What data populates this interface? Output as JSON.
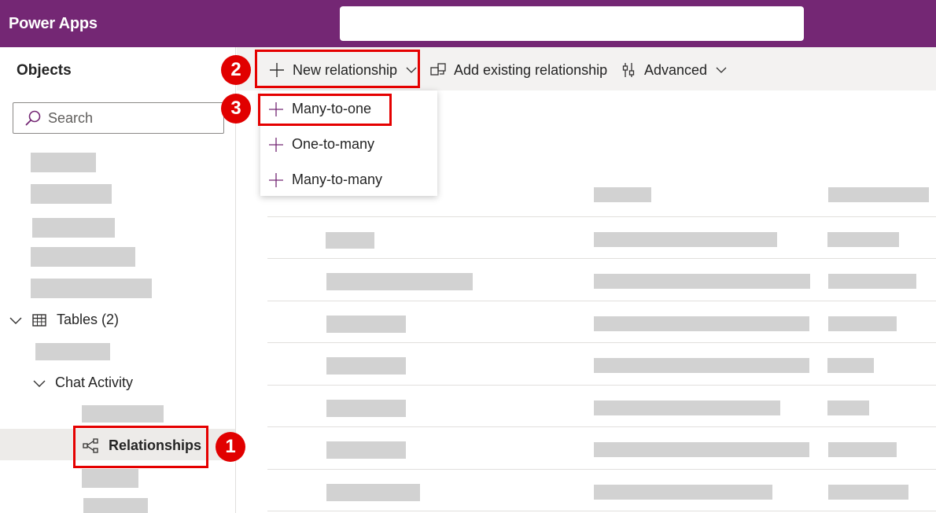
{
  "header": {
    "app_title": "Power Apps",
    "search_placeholder": ""
  },
  "sidebar": {
    "title": "Objects",
    "search_placeholder": "Search",
    "tables_label": "Tables (2)",
    "chat_activity_label": "Chat Activity",
    "relationships_label": "Relationships"
  },
  "command_bar": {
    "new_relationship": "New relationship",
    "add_existing": "Add existing relationship",
    "advanced": "Advanced"
  },
  "dropdown": {
    "items": [
      "Many-to-one",
      "One-to-many",
      "Many-to-many"
    ]
  },
  "callouts": {
    "one": "1",
    "two": "2",
    "three": "3"
  },
  "colors": {
    "brand": "#742774",
    "callout": "#e10000",
    "placeholder": "#d2d2d2"
  },
  "icons": [
    "search-icon",
    "chevron-down-icon",
    "table-icon",
    "relationship-icon",
    "plus-icon",
    "add-existing-icon",
    "advanced-icon"
  ]
}
